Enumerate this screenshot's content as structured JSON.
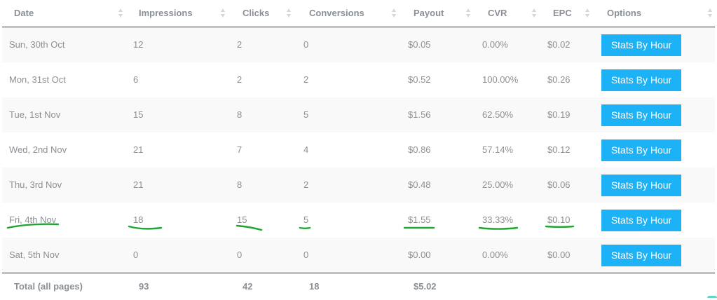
{
  "columns": [
    "Date",
    "Impressions",
    "Clicks",
    "Conversions",
    "Payout",
    "CVR",
    "EPC",
    "Options"
  ],
  "rows": [
    {
      "date": "Sun, 30th Oct",
      "impressions": "12",
      "clicks": "2",
      "conversions": "0",
      "payout": "$0.05",
      "cvr": "0.00%",
      "epc": "$0.02",
      "button": "Stats By Hour"
    },
    {
      "date": "Mon, 31st Oct",
      "impressions": "6",
      "clicks": "2",
      "conversions": "2",
      "payout": "$0.52",
      "cvr": "100.00%",
      "epc": "$0.26",
      "button": "Stats By Hour"
    },
    {
      "date": "Tue, 1st Nov",
      "impressions": "15",
      "clicks": "8",
      "conversions": "5",
      "payout": "$1.56",
      "cvr": "62.50%",
      "epc": "$0.19",
      "button": "Stats By Hour"
    },
    {
      "date": "Wed, 2nd Nov",
      "impressions": "21",
      "clicks": "7",
      "conversions": "4",
      "payout": "$0.86",
      "cvr": "57.14%",
      "epc": "$0.12",
      "button": "Stats By Hour"
    },
    {
      "date": "Thu, 3rd Nov",
      "impressions": "21",
      "clicks": "8",
      "conversions": "2",
      "payout": "$0.48",
      "cvr": "25.00%",
      "epc": "$0.06",
      "button": "Stats By Hour"
    },
    {
      "date": "Fri, 4th Nov",
      "impressions": "18",
      "clicks": "15",
      "conversions": "5",
      "payout": "$1.55",
      "cvr": "33.33%",
      "epc": "$0.10",
      "button": "Stats By Hour"
    },
    {
      "date": "Sat, 5th Nov",
      "impressions": "0",
      "clicks": "0",
      "conversions": "0",
      "payout": "$0.00",
      "cvr": "0.00%",
      "epc": "$0.00",
      "button": "Stats By Hour"
    }
  ],
  "totals": {
    "label": "Total (all pages)",
    "impressions": "93",
    "clicks": "42",
    "conversions": "18",
    "payout": "$5.02"
  },
  "colors": {
    "button": "#1cb2f5",
    "highlight": "#1fa531",
    "text": "#8c8f94",
    "header_text": "#8a8f96"
  }
}
